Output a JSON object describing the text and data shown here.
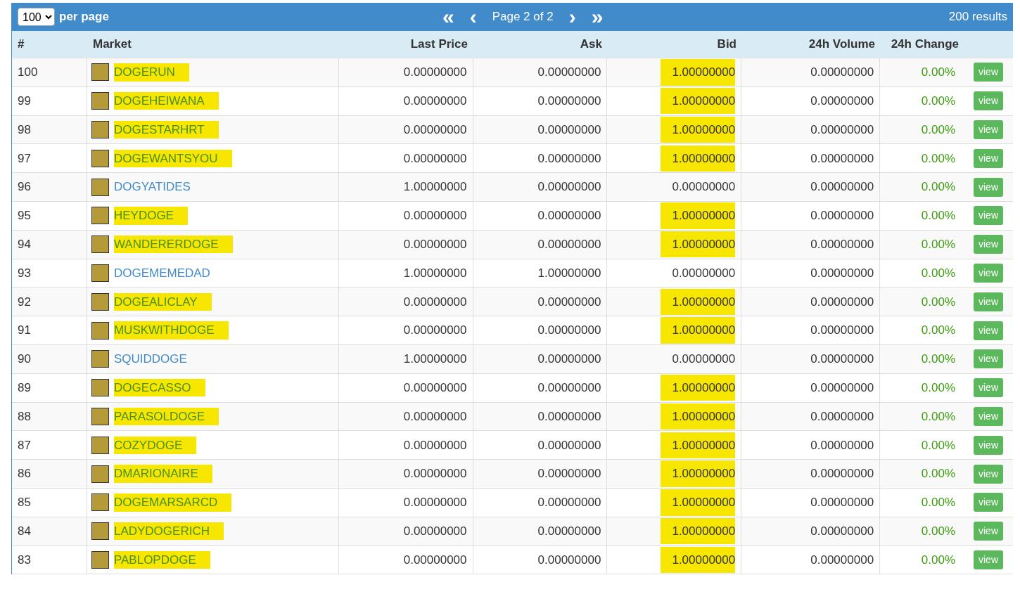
{
  "toolbar": {
    "per_page_value": "100",
    "per_page_label": "per page",
    "first": "«",
    "prev": "‹",
    "page_label": "Page 2 of 2",
    "next": "›",
    "last": "»",
    "results": "200 results"
  },
  "table": {
    "columns": [
      "#",
      "Market",
      "Last Price",
      "Ask",
      "Bid",
      "24h Volume",
      "24h Change"
    ],
    "rows": [
      {
        "num": "100",
        "market": "DOGERUN",
        "last": "0.00000000",
        "ask": "0.00000000",
        "bid": "1.00000000",
        "volume": "0.00000000",
        "change": "0.00%",
        "action": "view",
        "market_highlighted": true,
        "bid_highlighted": true
      },
      {
        "num": "99",
        "market": "DOGEHEIWANA",
        "last": "0.00000000",
        "ask": "0.00000000",
        "bid": "1.00000000",
        "volume": "0.00000000",
        "change": "0.00%",
        "action": "view",
        "market_highlighted": true,
        "bid_highlighted": true
      },
      {
        "num": "98",
        "market": "DOGESTARHRT",
        "last": "0.00000000",
        "ask": "0.00000000",
        "bid": "1.00000000",
        "volume": "0.00000000",
        "change": "0.00%",
        "action": "view",
        "market_highlighted": true,
        "bid_highlighted": true
      },
      {
        "num": "97",
        "market": "DOGEWANTSYOU",
        "last": "0.00000000",
        "ask": "0.00000000",
        "bid": "1.00000000",
        "volume": "0.00000000",
        "change": "0.00%",
        "action": "view",
        "market_highlighted": true,
        "bid_highlighted": true
      },
      {
        "num": "96",
        "market": "DOGYATIDES",
        "last": "1.00000000",
        "ask": "0.00000000",
        "bid": "0.00000000",
        "volume": "0.00000000",
        "change": "0.00%",
        "action": "view",
        "market_highlighted": false,
        "bid_highlighted": false
      },
      {
        "num": "95",
        "market": "HEYDOGE",
        "last": "0.00000000",
        "ask": "0.00000000",
        "bid": "1.00000000",
        "volume": "0.00000000",
        "change": "0.00%",
        "action": "view",
        "market_highlighted": true,
        "bid_highlighted": true
      },
      {
        "num": "94",
        "market": "WANDERERDOGE",
        "last": "0.00000000",
        "ask": "0.00000000",
        "bid": "1.00000000",
        "volume": "0.00000000",
        "change": "0.00%",
        "action": "view",
        "market_highlighted": true,
        "bid_highlighted": true
      },
      {
        "num": "93",
        "market": "DOGEMEMEDAD",
        "last": "1.00000000",
        "ask": "1.00000000",
        "bid": "0.00000000",
        "volume": "0.00000000",
        "change": "0.00%",
        "action": "view",
        "market_highlighted": false,
        "bid_highlighted": false
      },
      {
        "num": "92",
        "market": "DOGEALICLAY",
        "last": "0.00000000",
        "ask": "0.00000000",
        "bid": "1.00000000",
        "volume": "0.00000000",
        "change": "0.00%",
        "action": "view",
        "market_highlighted": true,
        "bid_highlighted": true
      },
      {
        "num": "91",
        "market": "MUSKWITHDOGE",
        "last": "0.00000000",
        "ask": "0.00000000",
        "bid": "1.00000000",
        "volume": "0.00000000",
        "change": "0.00%",
        "action": "view",
        "market_highlighted": true,
        "bid_highlighted": true
      },
      {
        "num": "90",
        "market": "SQUIDDOGE",
        "last": "1.00000000",
        "ask": "0.00000000",
        "bid": "0.00000000",
        "volume": "0.00000000",
        "change": "0.00%",
        "action": "view",
        "market_highlighted": false,
        "bid_highlighted": false
      },
      {
        "num": "89",
        "market": "DOGECASSO",
        "last": "0.00000000",
        "ask": "0.00000000",
        "bid": "1.00000000",
        "volume": "0.00000000",
        "change": "0.00%",
        "action": "view",
        "market_highlighted": true,
        "bid_highlighted": true
      },
      {
        "num": "88",
        "market": "PARASOLDOGE",
        "last": "0.00000000",
        "ask": "0.00000000",
        "bid": "1.00000000",
        "volume": "0.00000000",
        "change": "0.00%",
        "action": "view",
        "market_highlighted": true,
        "bid_highlighted": true
      },
      {
        "num": "87",
        "market": "COZYDOGE",
        "last": "0.00000000",
        "ask": "0.00000000",
        "bid": "1.00000000",
        "volume": "0.00000000",
        "change": "0.00%",
        "action": "view",
        "market_highlighted": true,
        "bid_highlighted": true
      },
      {
        "num": "86",
        "market": "DMARIONAIRE",
        "last": "0.00000000",
        "ask": "0.00000000",
        "bid": "1.00000000",
        "volume": "0.00000000",
        "change": "0.00%",
        "action": "view",
        "market_highlighted": true,
        "bid_highlighted": true
      },
      {
        "num": "85",
        "market": "DOGEMARSARCD",
        "last": "0.00000000",
        "ask": "0.00000000",
        "bid": "1.00000000",
        "volume": "0.00000000",
        "change": "0.00%",
        "action": "view",
        "market_highlighted": true,
        "bid_highlighted": true
      },
      {
        "num": "84",
        "market": "LADYDOGERICH",
        "last": "0.00000000",
        "ask": "0.00000000",
        "bid": "1.00000000",
        "volume": "0.00000000",
        "change": "0.00%",
        "action": "view",
        "market_highlighted": true,
        "bid_highlighted": true
      },
      {
        "num": "83",
        "market": "PABLOPDOGE",
        "last": "0.00000000",
        "ask": "0.00000000",
        "bid": "1.00000000",
        "volume": "0.00000000",
        "change": "0.00%",
        "action": "view",
        "market_highlighted": true,
        "bid_highlighted": true
      }
    ]
  }
}
